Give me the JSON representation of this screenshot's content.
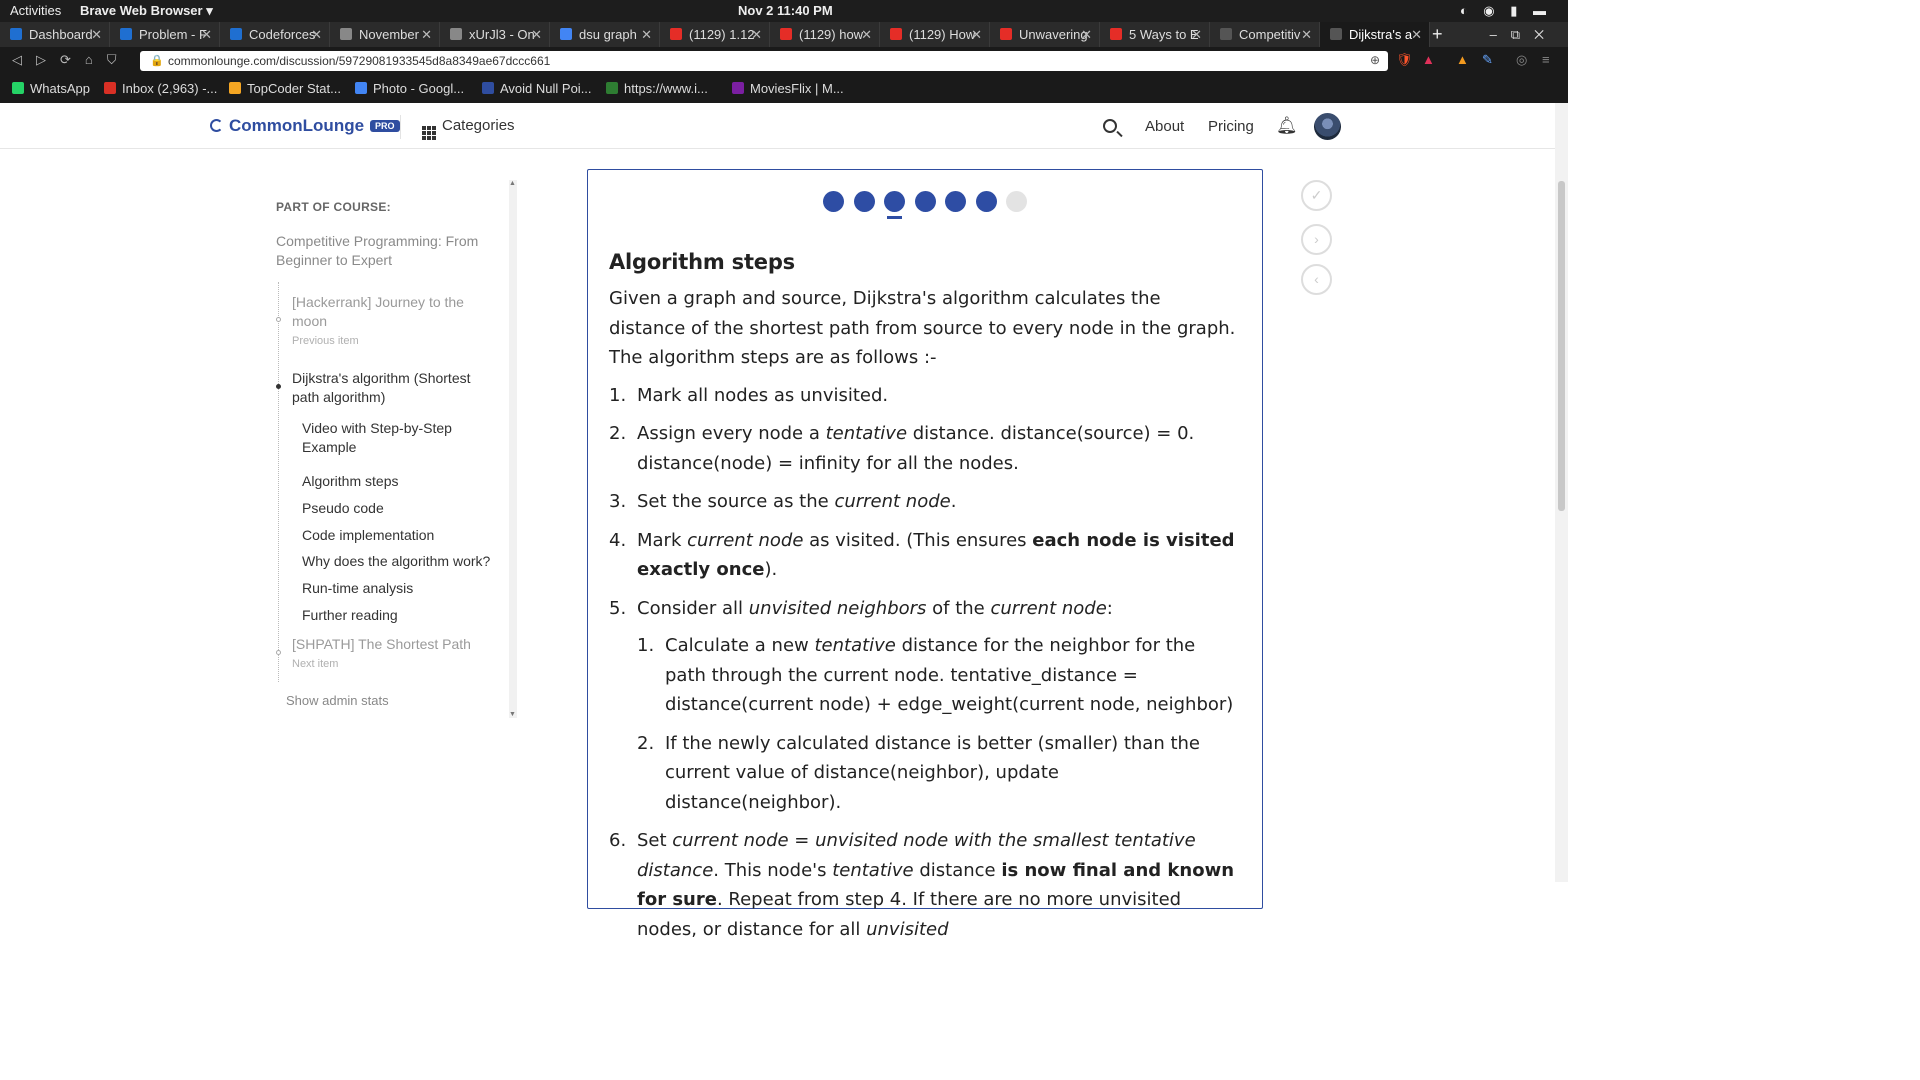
{
  "os": {
    "activities": "Activities",
    "browser_menu": "Brave Web Browser ▾",
    "clock": "Nov 2  11:40 PM"
  },
  "tabs": [
    {
      "label": "Dashboard",
      "color": "#1f6fd1"
    },
    {
      "label": "Problem - F",
      "color": "#1f6fd1"
    },
    {
      "label": "Codeforces",
      "color": "#1f6fd1"
    },
    {
      "label": "November",
      "color": "#888888"
    },
    {
      "label": "xUrJl3 - On",
      "color": "#888888"
    },
    {
      "label": "dsu graph",
      "color": "#4285f4"
    },
    {
      "label": "(1129) 1.12",
      "color": "#e52d27"
    },
    {
      "label": "(1129) how",
      "color": "#e52d27"
    },
    {
      "label": "(1129) How",
      "color": "#e52d27"
    },
    {
      "label": "Unwavering",
      "color": "#e52d27"
    },
    {
      "label": "5 Ways to E",
      "color": "#e52d27"
    },
    {
      "label": "Competitiv",
      "color": "#555555"
    },
    {
      "label": "Dijkstra's a",
      "color": "#555555"
    }
  ],
  "address": {
    "url": "commonlounge.com/discussion/59729081933545d8a8349ae67dccc661"
  },
  "bookmarks": [
    {
      "label": "WhatsApp",
      "color": "#25d366"
    },
    {
      "label": "Inbox (2,963) -...",
      "color": "#d93025"
    },
    {
      "label": "TopCoder Stat...",
      "color": "#f5a623"
    },
    {
      "label": "Photo - Googl...",
      "color": "#4285f4"
    },
    {
      "label": "Avoid Null Poi...",
      "color": "#2f4da0"
    },
    {
      "label": "https://www.i...",
      "color": "#2e7d32"
    },
    {
      "label": "MoviesFlix | M...",
      "color": "#7b1fa2"
    }
  ],
  "site": {
    "logo": "CommonLounge",
    "badge": "PRO",
    "categories": "Categories",
    "about": "About",
    "pricing": "Pricing"
  },
  "sidebar": {
    "heading": "PART OF COURSE:",
    "course": "Competitive Programming: From Beginner to Expert",
    "prev_title": "[Hackerrank] Journey to the moon",
    "prev_label": "Previous item",
    "current_title": "Dijkstra's algorithm (Shortest path algorithm)",
    "children": [
      "Video with Step-by-Step Example",
      "Algorithm steps",
      "Pseudo code",
      "Code implementation",
      "Why does the algorithm work?",
      "Run-time analysis",
      "Further reading"
    ],
    "next_title": "[SHPATH] The Shortest Path",
    "next_label": "Next item",
    "admin": "Show admin stats"
  },
  "progress": {
    "total": 7,
    "completed": 6,
    "current_index": 3
  },
  "article": {
    "title": "Algorithm steps",
    "intro": "Given a graph and source, Dijkstra's algorithm calculates the distance of the shortest path from source to every node in the graph. The algorithm steps are as follows :-",
    "steps": [
      {
        "num": "1.",
        "html": "Mark all nodes as unvisited."
      },
      {
        "num": "2.",
        "html": "Assign every node a <i>tentative</i> distance. distance(source) = 0. distance(node) = infinity for all the nodes."
      },
      {
        "num": "3.",
        "html": "Set the source as the <i>current node</i>."
      },
      {
        "num": "4.",
        "html": "Mark <i>current node</i> as visited. (This ensures <b>each node is visited exactly once</b>)."
      },
      {
        "num": "5.",
        "html": "Consider all <i>unvisited neighbors</i> of the <i>current node</i>:",
        "sub": [
          {
            "num": "1.",
            "html": "Calculate a new <i>tentative</i> distance for the neighbor for the path through the current node. tentative_distance = distance(current node) + edge_weight(current node, neighbor)"
          },
          {
            "num": "2.",
            "html": "If the newly calculated distance is better (smaller) than the current value of distance(neighbor), update distance(neighbor)."
          }
        ]
      },
      {
        "num": "6.",
        "html": "Set <i>current node</i> = <i>unvisited node with the smallest tentative distance</i>. This node's <i>tentative</i> distance <b>is now final and known for sure</b>. Repeat from step 4. If there are no more unvisited nodes, or distance for all <i>unvisited</i>"
      }
    ]
  }
}
